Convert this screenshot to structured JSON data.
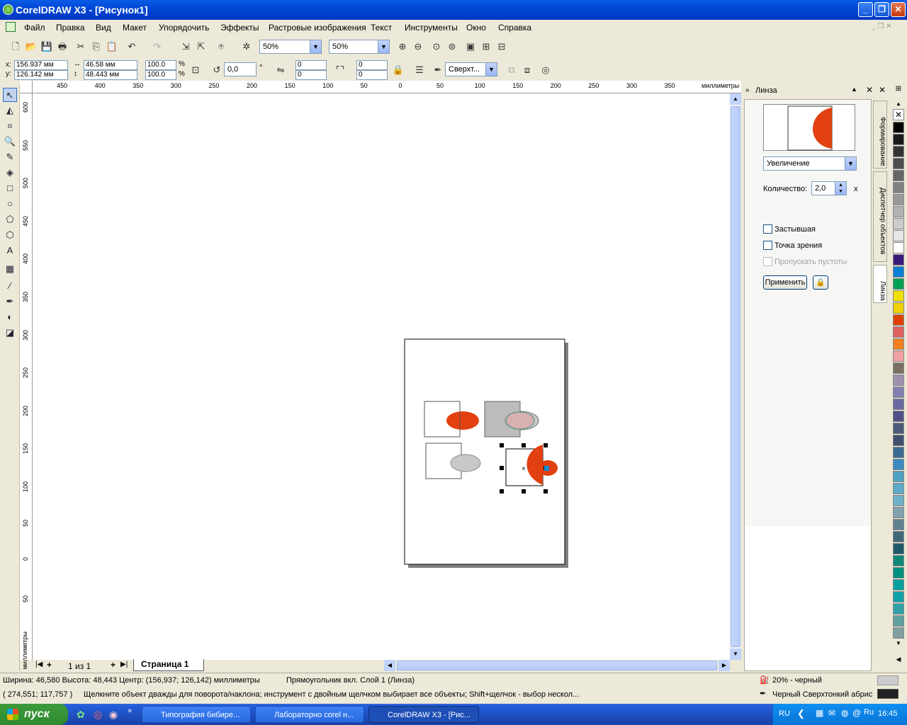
{
  "window": {
    "title": "CorelDRAW X3 - [Рисунок1]"
  },
  "menu": [
    "Файл",
    "Правка",
    "Вид",
    "Макет",
    "Упорядочить",
    "Эффекты",
    "Растровые изображения",
    "Текст",
    "Инструменты",
    "Окно",
    "Справка"
  ],
  "toolbar": {
    "zoom1": "50%",
    "zoom2": "50%"
  },
  "props": {
    "x": "156.937 мм",
    "y": "126.142 мм",
    "w": "46.58 мм",
    "h": "48.443 мм",
    "sx": "100.0",
    "sy": "100.0",
    "pct": "%",
    "angle": "0,0",
    "deg": "°",
    "r1": "0",
    "r2": "0",
    "r3": "0",
    "r4": "0",
    "wrap": "Сверхт..."
  },
  "hruler": {
    "ticks": [
      "450",
      "400",
      "350",
      "300",
      "250",
      "200",
      "150",
      "100",
      "50",
      "0",
      "50",
      "100",
      "150",
      "200",
      "250",
      "300",
      "350"
    ],
    "unit": "миллиметры"
  },
  "vruler": {
    "ticks": [
      "600",
      "550",
      "500",
      "450",
      "400",
      "350",
      "300",
      "250",
      "200",
      "150",
      "100",
      "50",
      "0",
      "50"
    ],
    "unit": "миллиметры"
  },
  "pages": {
    "counter": "1 из 1",
    "tab": "Страница 1"
  },
  "docker": {
    "title": "Линза",
    "mode": "Увеличение",
    "amount_label": "Количество:",
    "amount": "2,0",
    "amount_unit": "x",
    "frozen": "Застывшая",
    "viewpoint": "Точка зрения",
    "skip_blank": "Пропускать пустоты",
    "apply": "Применить",
    "tabs": [
      "Формирование",
      "Диспетчер объектов",
      "Линза"
    ]
  },
  "palette": [
    "#000000",
    "#1a1a1a",
    "#333333",
    "#4d4d4d",
    "#666666",
    "#808080",
    "#999999",
    "#b3b3b3",
    "#cccccc",
    "#e6e6e6",
    "#ffffff",
    "#3a1a7a",
    "#0a7ed0",
    "#00a050",
    "#f0e000",
    "#f0d000",
    "#e04000",
    "#e06060",
    "#f08020",
    "#f0a0a0",
    "#7a7060",
    "#a090b0",
    "#8080b0",
    "#6a6aa0",
    "#505088",
    "#4a5a7a",
    "#405070",
    "#3a6a90",
    "#3a8ac0",
    "#50a0c0",
    "#60a8c8",
    "#70b0c8",
    "#80a0b0",
    "#608090",
    "#406878",
    "#205868",
    "#108878",
    "#009080",
    "#00a0a0",
    "#10a0a8",
    "#30a0a8",
    "#60a0a0",
    "#80a0a0"
  ],
  "status": {
    "line1": "Ширина: 46,580  Высота: 48,443  Центр: (156,937; 126,142)  миллиметры",
    "object": "Прямоугольник вкл. Слой 1  (Линза)",
    "fill": "20% - черный",
    "coords": "( 274,551; 117,757 )",
    "hint": "Щелкните объект дважды для поворота/наклона; инструмент с двойным щелчком выбирает все объекты; Shift+щелчок - выбор нескол...",
    "outline": "Черный  Сверхтонкий абрис"
  },
  "taskbar": {
    "start": "пуск",
    "tasks": [
      "Типография бибире...",
      "Лабораторно corel н...",
      "CorelDRAW X3 - [Рис..."
    ],
    "lang": "RU",
    "clock": "16:45"
  }
}
